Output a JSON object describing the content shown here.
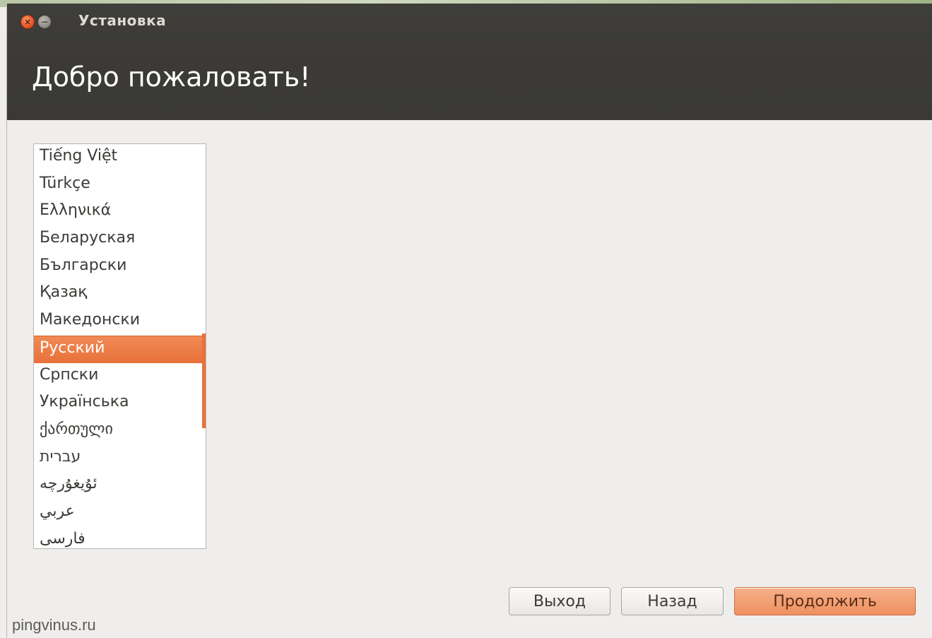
{
  "window": {
    "title": "Установка",
    "close_glyph": "×",
    "minimize_glyph": "−"
  },
  "header": {
    "title": "Добро пожаловать!"
  },
  "languages": {
    "items": [
      "Tiếng Việt",
      "Türkçe",
      "Ελληνικά",
      "Беларуская",
      "Български",
      "Қазақ",
      "Македонски",
      "Русский",
      "Српски",
      "Українська",
      "ქართული",
      "עברית",
      "ئۇيغۇرچە",
      "عربي",
      "فارسی"
    ],
    "selected": "Русский"
  },
  "buttons": {
    "quit": "Выход",
    "back": "Назад",
    "continue": "Продолжить"
  },
  "watermark": "pingvinus.ru",
  "colors": {
    "accent": "#e8713a",
    "titlebar": "#3c3b37",
    "background": "#efeeec"
  }
}
